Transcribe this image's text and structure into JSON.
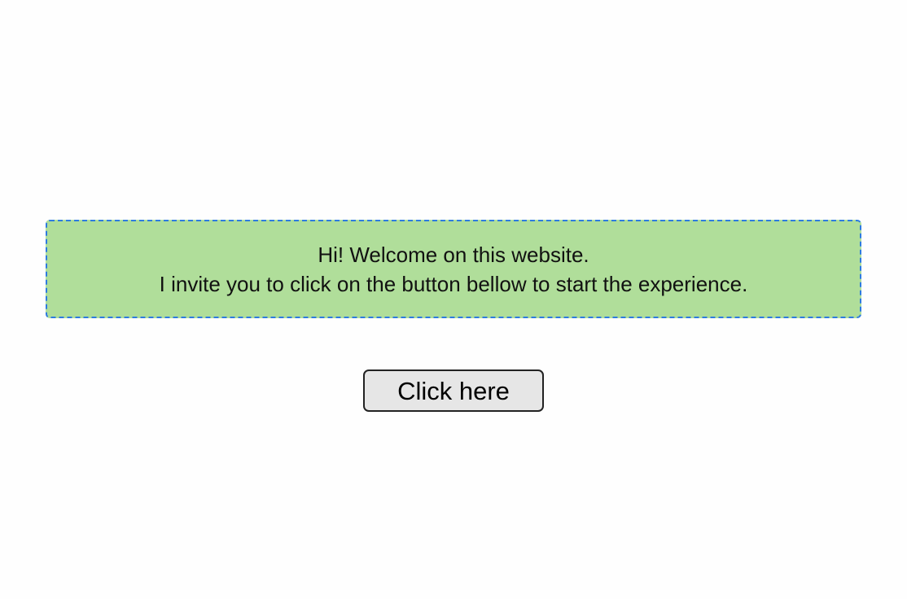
{
  "welcome": {
    "line1": "Hi! Welcome on this website.",
    "line2": "I invite you to click on the button bellow to start the experience."
  },
  "cta": {
    "label": "Click here"
  },
  "colors": {
    "page_background": "#fefefe",
    "box_background": "#b0de9a",
    "box_border": "#2e7be0",
    "button_background": "#e6e6e6",
    "button_border": "#222222"
  }
}
